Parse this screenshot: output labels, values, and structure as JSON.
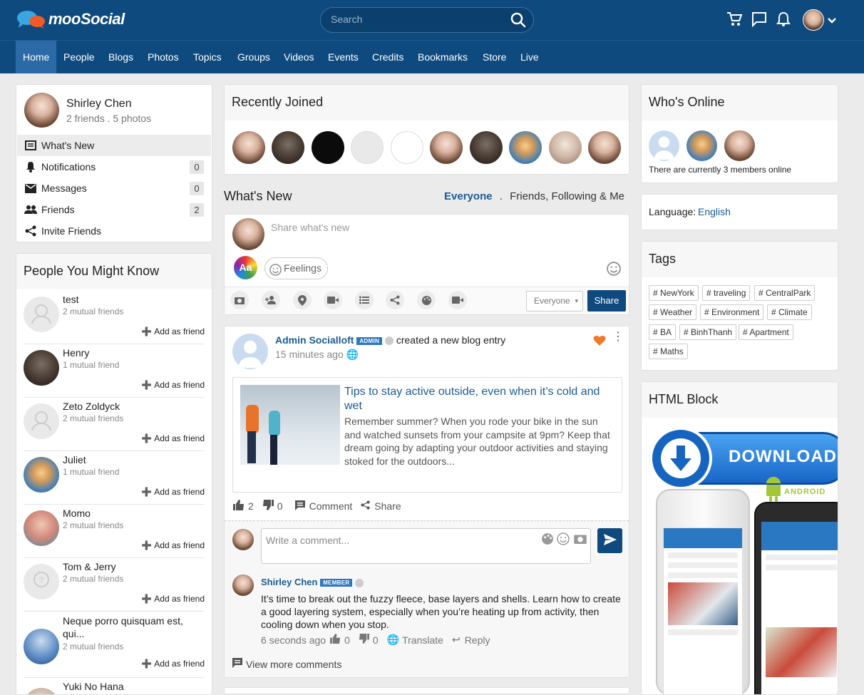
{
  "app": {
    "logo_text": "mooSocial"
  },
  "search": {
    "placeholder": "Search"
  },
  "nav": {
    "items": [
      "Home",
      "People",
      "Blogs",
      "Photos",
      "Topics",
      "Groups",
      "Videos",
      "Events",
      "Credits",
      "Bookmarks",
      "Store",
      "Live"
    ]
  },
  "profile": {
    "name": "Shirley Chen",
    "stats": "2 friends . 5 photos"
  },
  "menu": [
    {
      "label": "What's New",
      "count": ""
    },
    {
      "label": "Notifications",
      "count": "0"
    },
    {
      "label": "Messages",
      "count": "0"
    },
    {
      "label": "Friends",
      "count": "2"
    },
    {
      "label": "Invite Friends",
      "count": ""
    }
  ],
  "pymk": {
    "title": "People You Might Know",
    "add_label": "Add as friend",
    "people": [
      {
        "name": "test",
        "mutual": "2 mutual friends"
      },
      {
        "name": "Henry",
        "mutual": "1 mutual friend"
      },
      {
        "name": "Zeto Zoldyck",
        "mutual": "2 mutual friends"
      },
      {
        "name": "Juliet",
        "mutual": "1 mutual friend"
      },
      {
        "name": "Momo",
        "mutual": "2 mutual friends"
      },
      {
        "name": "Tom & Jerry",
        "mutual": "2 mutual friends"
      },
      {
        "name": "Neque porro quisquam est, qui...",
        "mutual": "2 mutual friends"
      },
      {
        "name": "Yuki No Hana",
        "mutual": ""
      }
    ]
  },
  "recent": {
    "title": "Recently Joined"
  },
  "whatsnew": {
    "title": "What's New",
    "filter_everyone": "Everyone",
    "filter_sep": ".",
    "filter_friends": "Friends, Following & Me"
  },
  "composer": {
    "placeholder": "Share what's new",
    "font_btn": "Aa",
    "feelings": "Feelings",
    "privacy": "Everyone",
    "share": "Share"
  },
  "post": {
    "author": "Admin Socialloft",
    "badge": "ADMIN",
    "action": "created a new blog entry",
    "time": "15 minutes ago",
    "blog_title": "Tips to stay active outside, even when it’s cold and wet",
    "blog_excerpt": "Remember summer? When you rode your bike in the sun and watched sunsets from your campsite at 9pm? Keep that dream going by adapting your outdoor activities and staying stoked for the outdoors...",
    "likes": "2",
    "dislikes": "0",
    "comment_label": "Comment",
    "share_label": "Share",
    "comment_placeholder": "Write a comment..."
  },
  "comment": {
    "author": "Shirley Chen",
    "badge": "MEMBER",
    "text": "It’s time to break out the fuzzy fleece, base layers and shells. Learn how to create a good layering system, especially when you’re heating up from activity, then cooling down when you stop.",
    "time": "6 seconds ago",
    "likes": "0",
    "dislikes": "0",
    "translate": "Translate",
    "reply": "Reply"
  },
  "view_more": "View more comments",
  "online": {
    "title": "Who's Online",
    "text": "There are currently 3 members online"
  },
  "language": {
    "label": "Language:",
    "value": "English"
  },
  "tags": {
    "title": "Tags",
    "items": [
      "# NewYork",
      "# traveling",
      "# CentralPark",
      "# Weather",
      "# Environment",
      "# Climate",
      "# BA",
      "# BinhThanh",
      "# Apartment",
      "# Maths"
    ]
  },
  "html_block": {
    "title": "HTML Block",
    "download": "DOWNLOAD",
    "android": "ANDROID"
  },
  "colors": {
    "brand": "#0e4a7e",
    "nav_active": "#2b6aa6",
    "accent": "#2b78c2",
    "link": "#1a5b94"
  }
}
